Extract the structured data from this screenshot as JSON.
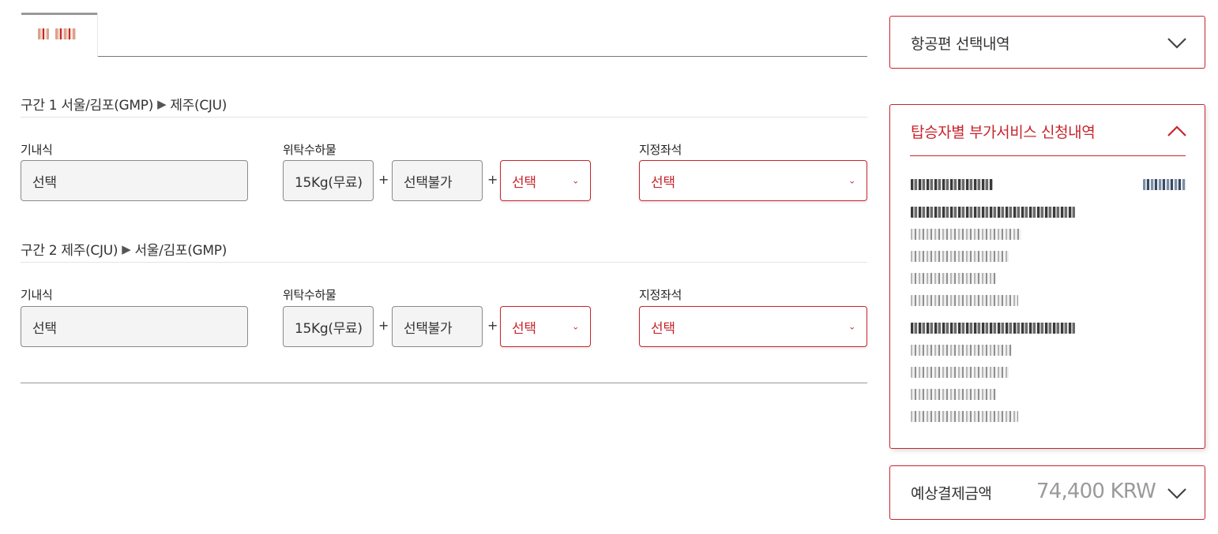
{
  "tab": {
    "label_redacted": "blurred tab label"
  },
  "segments": [
    {
      "title": "구간 1 서울/김포(GMP)",
      "arrow": "▶",
      "destination": "제주(CJU)",
      "meal_label": "기내식",
      "meal_value": "선택",
      "baggage_label": "위탁수하물",
      "baggage_free": "15Kg(무료)",
      "plus": "+",
      "baggage_unavailable": "선택불가",
      "baggage_select": "선택",
      "seat_label": "지정좌석",
      "seat_value": "선택"
    },
    {
      "title": "구간 2 제주(CJU)",
      "arrow": "▶",
      "destination": "서울/김포(GMP)",
      "meal_label": "기내식",
      "meal_value": "선택",
      "baggage_label": "위탁수하물",
      "baggage_free": "15Kg(무료)",
      "plus": "+",
      "baggage_unavailable": "선택불가",
      "baggage_select": "선택",
      "seat_label": "지정좌석",
      "seat_value": "선택"
    }
  ],
  "summary": {
    "flight_selection_title": "항공편 선택내역",
    "addon_title": "탑승자별 부가서비스 신청내역",
    "total_label": "예상결제금액",
    "total_value": "74,400 KRW"
  },
  "colors": {
    "accent": "#c8242c",
    "border_gray": "#8a8a8a",
    "muted_text": "#9a9a9a"
  },
  "icons": {
    "chevron_down": "chevron-down-icon",
    "chevron_up": "chevron-up-icon",
    "select_caret": "caret-down-icon"
  }
}
